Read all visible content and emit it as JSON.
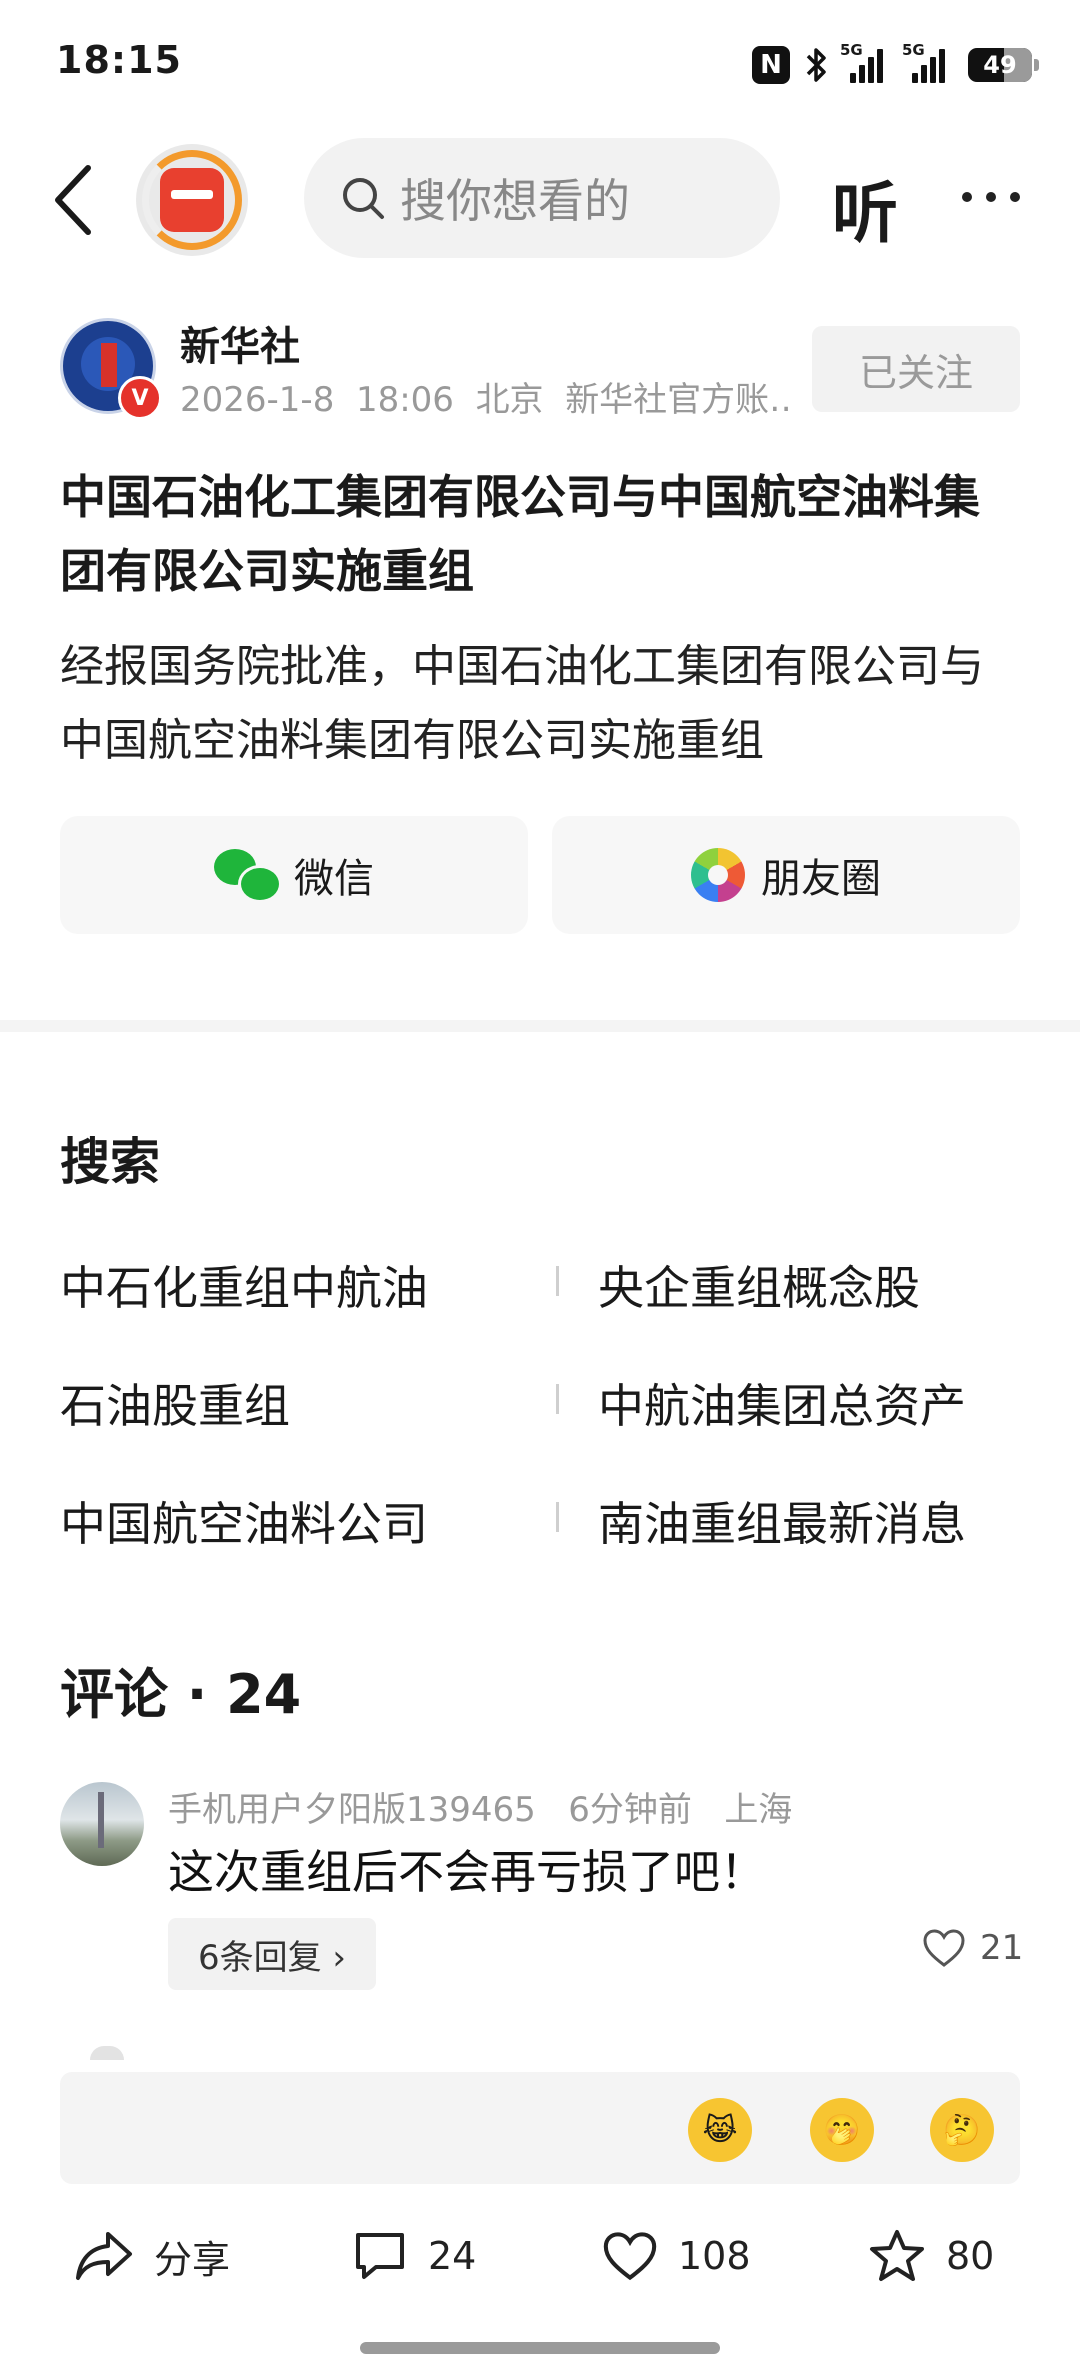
{
  "status_bar": {
    "time": "18:15",
    "battery": "49",
    "net1": "5G",
    "net2": "5G",
    "nfc": "N"
  },
  "nav": {
    "search_placeholder": "搜你想看的",
    "listen_label": "听"
  },
  "author": {
    "name": "新华社",
    "date": "2026-1-8",
    "time": "18:06",
    "location": "北京",
    "desc": "新华社官方账…",
    "follow_label": "已关注",
    "badge": "V"
  },
  "article": {
    "title": "中国石油化工集团有限公司与中国航空油料集团有限公司实施重组",
    "summary": "经报国务院批准，中国石油化工集团有限公司与中国航空油料集团有限公司实施重组"
  },
  "share": {
    "wechat_label": "微信",
    "moments_label": "朋友圈"
  },
  "search_section": {
    "title": "搜索",
    "items": [
      "中石化重组中航油",
      "央企重组概念股",
      "石油股重组",
      "中航油集团总资产",
      "中国航空油料公司",
      "南油重组最新消息"
    ]
  },
  "comments": {
    "title": "评论 · 24",
    "items": [
      {
        "user": "手机用户夕阳版139465",
        "time": "6分钟前",
        "location": "上海",
        "text": "这次重组后不会再亏损了吧！",
        "replies": "6条回复 ›",
        "likes": "21"
      }
    ]
  },
  "emojis": [
    "😹",
    "🤭",
    "🤔"
  ],
  "bottom_bar": {
    "share_label": "分享",
    "comment_count": "24",
    "like_count": "108",
    "fav_count": "80"
  }
}
